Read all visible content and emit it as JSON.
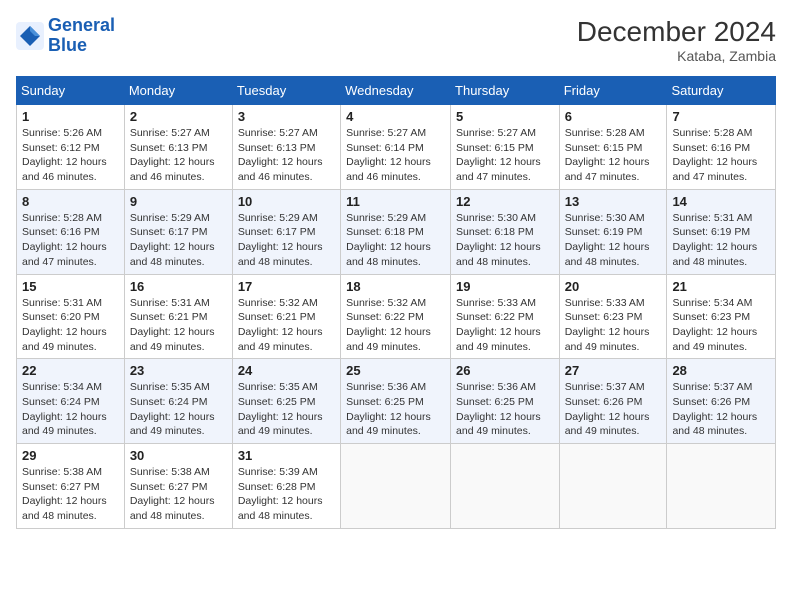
{
  "header": {
    "logo_line1": "General",
    "logo_line2": "Blue",
    "month_year": "December 2024",
    "location": "Kataba, Zambia"
  },
  "weekdays": [
    "Sunday",
    "Monday",
    "Tuesday",
    "Wednesday",
    "Thursday",
    "Friday",
    "Saturday"
  ],
  "weeks": [
    [
      {
        "day": "1",
        "sunrise": "5:26 AM",
        "sunset": "6:12 PM",
        "daylight": "12 hours and 46 minutes."
      },
      {
        "day": "2",
        "sunrise": "5:27 AM",
        "sunset": "6:13 PM",
        "daylight": "12 hours and 46 minutes."
      },
      {
        "day": "3",
        "sunrise": "5:27 AM",
        "sunset": "6:13 PM",
        "daylight": "12 hours and 46 minutes."
      },
      {
        "day": "4",
        "sunrise": "5:27 AM",
        "sunset": "6:14 PM",
        "daylight": "12 hours and 46 minutes."
      },
      {
        "day": "5",
        "sunrise": "5:27 AM",
        "sunset": "6:15 PM",
        "daylight": "12 hours and 47 minutes."
      },
      {
        "day": "6",
        "sunrise": "5:28 AM",
        "sunset": "6:15 PM",
        "daylight": "12 hours and 47 minutes."
      },
      {
        "day": "7",
        "sunrise": "5:28 AM",
        "sunset": "6:16 PM",
        "daylight": "12 hours and 47 minutes."
      }
    ],
    [
      {
        "day": "8",
        "sunrise": "5:28 AM",
        "sunset": "6:16 PM",
        "daylight": "12 hours and 47 minutes."
      },
      {
        "day": "9",
        "sunrise": "5:29 AM",
        "sunset": "6:17 PM",
        "daylight": "12 hours and 48 minutes."
      },
      {
        "day": "10",
        "sunrise": "5:29 AM",
        "sunset": "6:17 PM",
        "daylight": "12 hours and 48 minutes."
      },
      {
        "day": "11",
        "sunrise": "5:29 AM",
        "sunset": "6:18 PM",
        "daylight": "12 hours and 48 minutes."
      },
      {
        "day": "12",
        "sunrise": "5:30 AM",
        "sunset": "6:18 PM",
        "daylight": "12 hours and 48 minutes."
      },
      {
        "day": "13",
        "sunrise": "5:30 AM",
        "sunset": "6:19 PM",
        "daylight": "12 hours and 48 minutes."
      },
      {
        "day": "14",
        "sunrise": "5:31 AM",
        "sunset": "6:19 PM",
        "daylight": "12 hours and 48 minutes."
      }
    ],
    [
      {
        "day": "15",
        "sunrise": "5:31 AM",
        "sunset": "6:20 PM",
        "daylight": "12 hours and 49 minutes."
      },
      {
        "day": "16",
        "sunrise": "5:31 AM",
        "sunset": "6:21 PM",
        "daylight": "12 hours and 49 minutes."
      },
      {
        "day": "17",
        "sunrise": "5:32 AM",
        "sunset": "6:21 PM",
        "daylight": "12 hours and 49 minutes."
      },
      {
        "day": "18",
        "sunrise": "5:32 AM",
        "sunset": "6:22 PM",
        "daylight": "12 hours and 49 minutes."
      },
      {
        "day": "19",
        "sunrise": "5:33 AM",
        "sunset": "6:22 PM",
        "daylight": "12 hours and 49 minutes."
      },
      {
        "day": "20",
        "sunrise": "5:33 AM",
        "sunset": "6:23 PM",
        "daylight": "12 hours and 49 minutes."
      },
      {
        "day": "21",
        "sunrise": "5:34 AM",
        "sunset": "6:23 PM",
        "daylight": "12 hours and 49 minutes."
      }
    ],
    [
      {
        "day": "22",
        "sunrise": "5:34 AM",
        "sunset": "6:24 PM",
        "daylight": "12 hours and 49 minutes."
      },
      {
        "day": "23",
        "sunrise": "5:35 AM",
        "sunset": "6:24 PM",
        "daylight": "12 hours and 49 minutes."
      },
      {
        "day": "24",
        "sunrise": "5:35 AM",
        "sunset": "6:25 PM",
        "daylight": "12 hours and 49 minutes."
      },
      {
        "day": "25",
        "sunrise": "5:36 AM",
        "sunset": "6:25 PM",
        "daylight": "12 hours and 49 minutes."
      },
      {
        "day": "26",
        "sunrise": "5:36 AM",
        "sunset": "6:25 PM",
        "daylight": "12 hours and 49 minutes."
      },
      {
        "day": "27",
        "sunrise": "5:37 AM",
        "sunset": "6:26 PM",
        "daylight": "12 hours and 49 minutes."
      },
      {
        "day": "28",
        "sunrise": "5:37 AM",
        "sunset": "6:26 PM",
        "daylight": "12 hours and 48 minutes."
      }
    ],
    [
      {
        "day": "29",
        "sunrise": "5:38 AM",
        "sunset": "6:27 PM",
        "daylight": "12 hours and 48 minutes."
      },
      {
        "day": "30",
        "sunrise": "5:38 AM",
        "sunset": "6:27 PM",
        "daylight": "12 hours and 48 minutes."
      },
      {
        "day": "31",
        "sunrise": "5:39 AM",
        "sunset": "6:28 PM",
        "daylight": "12 hours and 48 minutes."
      },
      null,
      null,
      null,
      null
    ]
  ]
}
